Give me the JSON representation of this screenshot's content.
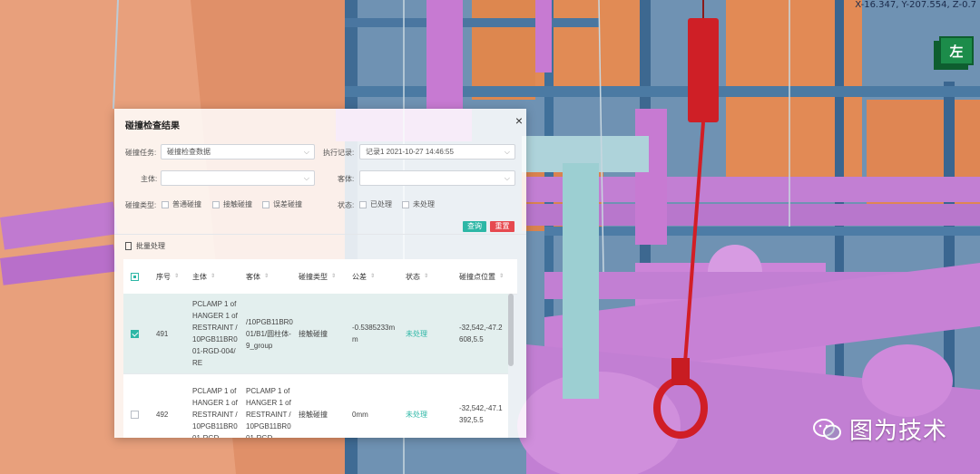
{
  "viewport": {
    "coords_text": "X-16.347, Y-207.554, Z-0.7",
    "view_cube_label": "左"
  },
  "watermark": {
    "text": "图为技术",
    "icon": "wechat-icon"
  },
  "dialog": {
    "title": "碰撞检查结果",
    "close_label": "×",
    "filters": {
      "task_label": "碰撞任务:",
      "task_value": "碰撞检查数据",
      "record_label": "执行记录:",
      "record_value": "记录1 2021-10-27 14:46:55",
      "subject_label": "主体:",
      "subject_value": "",
      "object_label": "客体:",
      "object_value": "",
      "type_label": "碰撞类型:",
      "type_options": [
        "普通碰撞",
        "接触碰撞",
        "误差碰撞"
      ],
      "status_label": "状态:",
      "status_options": [
        "已处理",
        "未处理"
      ]
    },
    "buttons": {
      "query": "查询",
      "reset": "重置"
    },
    "batch_label": "批量处理",
    "table": {
      "columns": [
        "序号",
        "主体",
        "客体",
        "碰撞类型",
        "公差",
        "状态",
        "碰撞点位置"
      ],
      "rows": [
        {
          "checked": true,
          "index": "491",
          "subject": "PCLAMP 1 of HANGER 1 of RESTRAINT /10PGB11BR001-RGD-004/RE",
          "object": "/10PGB11BR001/B1/圆柱体-9_group",
          "type": "接触碰撞",
          "tolerance": "-0.5385233mm",
          "status": "未处理",
          "position": "-32,542,-47.2608,5.5"
        },
        {
          "checked": false,
          "index": "492",
          "subject": "PCLAMP 1 of HANGER 1 of RESTRAINT /10PGB11BR001-RGD-",
          "object": "PCLAMP 1 of HANGER 1 of RESTRAINT /10PGB11BR001-RGD-",
          "type": "接触碰撞",
          "tolerance": "0mm",
          "status": "未处理",
          "position": "-32,542,-47.1392,5.5"
        }
      ]
    }
  },
  "colors": {
    "accent": "#2db7a6",
    "danger": "#e6494f",
    "selected_row": "#e3efee",
    "pipe_magenta": "#c97ad4",
    "hanger_red": "#d41f2a",
    "beam_blue": "#4a6e96",
    "wall_orange": "#e08a5e"
  }
}
